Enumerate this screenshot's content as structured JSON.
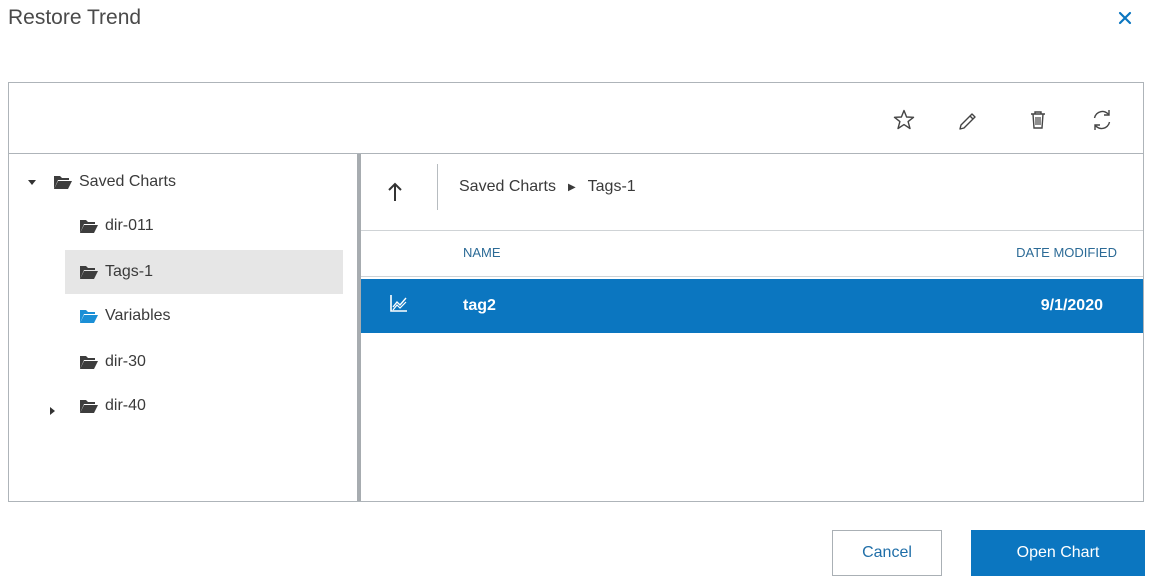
{
  "dialog": {
    "title": "Restore Trend"
  },
  "toolbar": {
    "icons": [
      "star-icon",
      "pencil-icon",
      "trash-icon",
      "refresh-icon"
    ]
  },
  "tree": {
    "items": [
      {
        "label": "Saved Charts",
        "expanded": true
      },
      {
        "label": "dir-011"
      },
      {
        "label": "Tags-1",
        "selected": true
      },
      {
        "label": "Variables",
        "folder_color": "#1b8fd6"
      },
      {
        "label": "dir-30"
      },
      {
        "label": "dir-40",
        "expanded": false
      }
    ]
  },
  "breadcrumb": {
    "items": [
      "Saved Charts",
      "Tags-1"
    ]
  },
  "table": {
    "columns": {
      "name": "NAME",
      "date": "DATE MODIFIED"
    },
    "rows": [
      {
        "name": "tag2",
        "date": "9/1/2020",
        "selected": true,
        "icon": "chart-icon"
      }
    ]
  },
  "buttons": {
    "cancel": "Cancel",
    "open": "Open Chart"
  },
  "colors": {
    "accent": "#0b76c0",
    "selected_row_bg": "#0b76c0",
    "tree_selected_bg": "#e6e6e6"
  }
}
